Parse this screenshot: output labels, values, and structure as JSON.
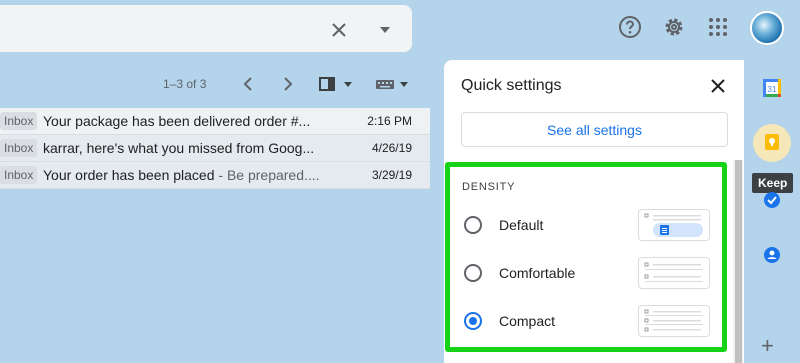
{
  "search": {
    "clear_icon": "close-icon",
    "options_icon": "caret-down-icon"
  },
  "header": {
    "icons": [
      "help-icon",
      "gear-icon",
      "apps-grid-icon",
      "avatar"
    ]
  },
  "toolbar": {
    "pager_text": "1–3 of 3",
    "prev_icon": "chevron-left-icon",
    "next_icon": "chevron-right-icon",
    "split_icon": "split-pane-icon",
    "keyboard_icon": "keyboard-icon"
  },
  "mails": [
    {
      "tag": "Inbox",
      "subject": "Your package has been delivered order #...",
      "snippet": "",
      "time": "2:16 PM"
    },
    {
      "tag": "Inbox",
      "subject": "karrar, here's what you missed from Goog...",
      "snippet": "",
      "time": "4/26/19"
    },
    {
      "tag": "Inbox",
      "subject": "Your order has been placed",
      "snippet": " - Be prepared....",
      "time": "3/29/19"
    }
  ],
  "quick_settings": {
    "title": "Quick settings",
    "see_all_label": "See all settings",
    "density": {
      "title": "DENSITY",
      "selected": "Compact",
      "options": [
        {
          "label": "Default"
        },
        {
          "label": "Comfortable"
        },
        {
          "label": "Compact"
        }
      ]
    }
  },
  "side_rail": {
    "calendar_day": "31",
    "keep_tooltip": "Keep",
    "icons": [
      "calendar-icon",
      "keep-icon",
      "tasks-icon",
      "contacts-icon",
      "add-icon"
    ]
  },
  "colors": {
    "highlight_border": "#17d317",
    "accent": "#1a73e8",
    "background": "#b3d4ea"
  }
}
